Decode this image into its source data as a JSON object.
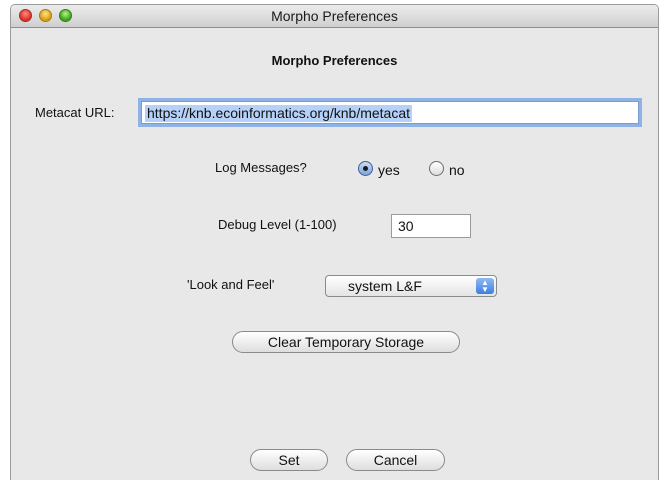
{
  "window": {
    "title": "Morpho Preferences"
  },
  "dialog": {
    "heading": "Morpho Preferences",
    "metacat_url": {
      "label": "Metacat URL:",
      "value": "https://knb.ecoinformatics.org/knb/metacat"
    },
    "log_messages": {
      "label": "Log Messages?",
      "options": [
        {
          "label": "yes",
          "selected": true
        },
        {
          "label": "no",
          "selected": false
        }
      ]
    },
    "debug_level": {
      "label": "Debug Level (1-100)",
      "value": "30"
    },
    "look_and_feel": {
      "label": "'Look and Feel'",
      "selected": "system L&F"
    },
    "clear_storage_label": "Clear Temporary Storage",
    "set_label": "Set",
    "cancel_label": "Cancel"
  },
  "colors": {
    "selection_highlight": "#b5d1f7",
    "focus_ring": "#8fb3e6",
    "window_bg": "#e8e8e8"
  },
  "icons": {
    "close": "close-icon",
    "minimize": "minimize-icon",
    "zoom": "zoom-icon",
    "select_arrows": "up-down-arrows-icon"
  }
}
